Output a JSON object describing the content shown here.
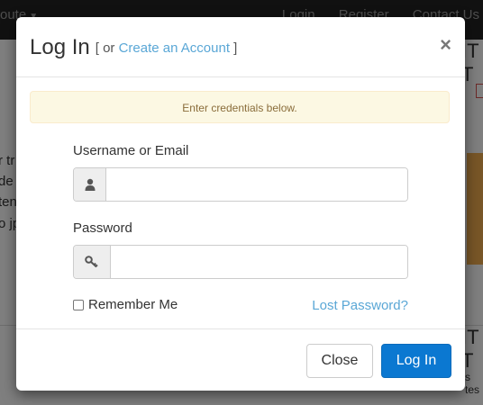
{
  "background": {
    "nav_brand": "oute",
    "nav_links": [
      "Login",
      "Register",
      "Contact Us"
    ],
    "fragments": [
      "r tr",
      "de",
      "ten",
      "o jp",
      "IT T",
      "IT T",
      "s tes"
    ]
  },
  "modal": {
    "title": "Log In",
    "subtitle_prefix": "[ or ",
    "subtitle_link": "Create an Account",
    "subtitle_suffix": " ]",
    "close_glyph": "×",
    "alert": "Enter credentials below.",
    "username_label": "Username or Email",
    "username_value": "",
    "password_label": "Password",
    "password_value": "",
    "remember_label": "Remember Me",
    "remember_checked": false,
    "lost_password": "Lost Password?",
    "close_button": "Close",
    "login_button": "Log In"
  },
  "colors": {
    "link": "#5aa7d6",
    "primary": "#0b78d1",
    "alert_bg": "#fcf8e3",
    "alert_text": "#8a6d3b"
  },
  "icons": {
    "username_addon": "user-icon",
    "password_addon": "key-icon"
  }
}
